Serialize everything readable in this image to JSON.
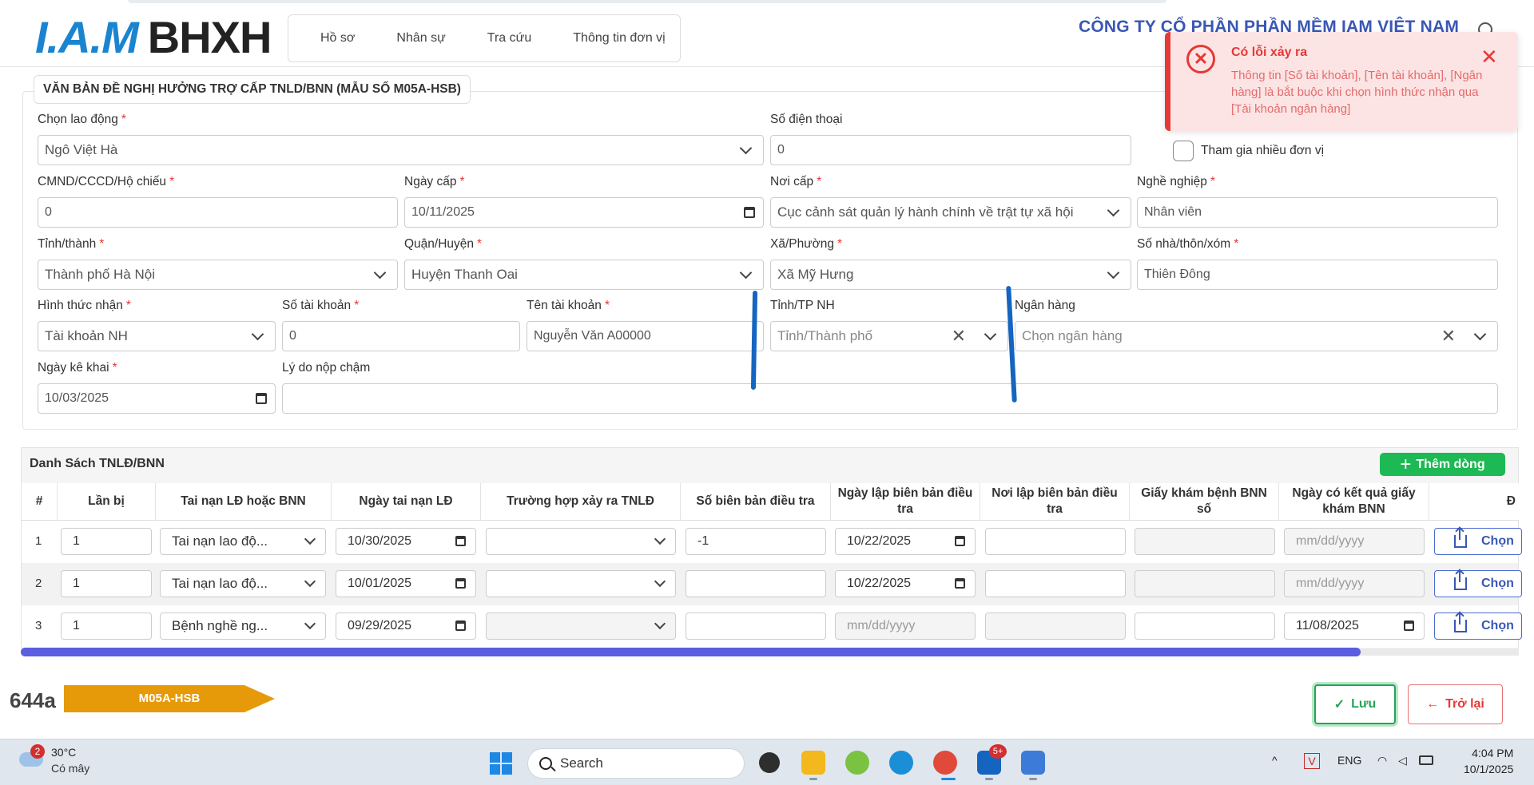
{
  "header": {
    "logo_iam": "I.A.M",
    "logo_bhxh": "BHXH",
    "nav": [
      "Hồ sơ",
      "Nhân sự",
      "Tra cứu",
      "Thông tin đơn vị"
    ],
    "company": "CÔNG TY CỔ PHẦN PHẦN MỀM IAM VIỆT NAM"
  },
  "toast": {
    "title": "Có lỗi xảy ra",
    "message": "Thông tin [Số tài khoản], [Tên tài khoản], [Ngân hàng] là bắt buộc khi chọn hình thức nhận qua [Tài khoản ngân hàng]",
    "close": "✕",
    "icon": "x-circle-icon"
  },
  "form": {
    "legend": "VĂN BẢN ĐỀ NGHỊ HƯỞNG TRỢ CẤP TNLD/BNN (MẪU SỐ M05A-HSB)",
    "required_mark": "*",
    "chon_lao_dong": {
      "label": "Chọn lao động",
      "value": "Ngô Việt Hà"
    },
    "so_dien_thoai": {
      "label": "Số điện thoại",
      "value": "0"
    },
    "tham_gia": {
      "label": "Tham gia nhiều đơn vị",
      "checked": false
    },
    "cmnd": {
      "label": "CMND/CCCD/Hộ chiếu",
      "value": "0"
    },
    "ngay_cap": {
      "label": "Ngày cấp",
      "value": "10/11/2025"
    },
    "noi_cap": {
      "label": "Nơi cấp",
      "value": "Cục cảnh sát quản lý hành chính về trật tự xã hội"
    },
    "nghe_nghiep": {
      "label": "Nghề nghiệp",
      "value": "Nhân viên"
    },
    "tinh_thanh": {
      "label": "Tỉnh/thành",
      "value": "Thành phố Hà Nội"
    },
    "quan_huyen": {
      "label": "Quận/Huyện",
      "value": "Huyện Thanh Oai"
    },
    "xa_phuong": {
      "label": "Xã/Phường",
      "value": "Xã Mỹ Hưng"
    },
    "so_nha": {
      "label": "Số nhà/thôn/xóm",
      "value": "Thiên Đông"
    },
    "hinh_thuc_nhan": {
      "label": "Hình thức nhận",
      "value": "Tài khoản NH"
    },
    "so_tai_khoan": {
      "label": "Số tài khoản",
      "value": "0"
    },
    "ten_tai_khoan": {
      "label": "Tên tài khoản",
      "value": "Nguyễn Văn A00000"
    },
    "tinh_tp_nh": {
      "label": "Tỉnh/TP NH",
      "placeholder": "Tỉnh/Thành phố"
    },
    "ngan_hang": {
      "label": "Ngân hàng",
      "placeholder": "Chọn ngân hàng"
    },
    "ngay_ke_khai": {
      "label": "Ngày kê khai",
      "value": "10/03/2025"
    },
    "ly_do": {
      "label": "Lý do nộp chậm",
      "value": ""
    },
    "clear_glyph": "✕"
  },
  "table": {
    "title": "Danh Sách TNLĐ/BNN",
    "add_label": "Thêm dòng",
    "add_icon": "+",
    "columns": [
      "#",
      "Lần bị",
      "Tai nạn LĐ hoặc BNN",
      "Ngày tai nạn LĐ",
      "Trường hợp xảy ra TNLĐ",
      "Số biên bản điều tra",
      "Ngày lập biên bản điều tra",
      "Nơi lập biên bản điều tra",
      "Giấy khám bệnh BNN số",
      "Ngày có kết quả giấy khám BNN",
      "Đ"
    ],
    "date_placeholder": "mm/dd/yyyy",
    "choose_label": "Chọn",
    "rows": [
      {
        "num": "1",
        "lan_bi": "1",
        "loai": "Tai nạn lao độ...",
        "ngay_tai_nan": "10/30/2025",
        "truong_hop": "",
        "so_bien_ban": "-1",
        "ngay_lap": "10/22/2025",
        "noi_lap": "",
        "giay_kham": "",
        "ngay_kq": ""
      },
      {
        "num": "2",
        "lan_bi": "1",
        "loai": "Tai nạn lao độ...",
        "ngay_tai_nan": "10/01/2025",
        "truong_hop": "",
        "so_bien_ban": "",
        "ngay_lap": "10/22/2025",
        "noi_lap": "",
        "giay_kham": "",
        "ngay_kq": ""
      },
      {
        "num": "3",
        "lan_bi": "1",
        "loai": "Bệnh nghề ng...",
        "ngay_tai_nan": "09/29/2025",
        "truong_hop": "",
        "so_bien_ban": "",
        "ngay_lap": "",
        "noi_lap": "",
        "giay_kham": "",
        "ngay_kq": "11/08/2025"
      }
    ]
  },
  "footer": {
    "code": "644a",
    "badge": "M05A-HSB",
    "save_label": "Lưu",
    "back_label": "Trở lại",
    "save_icon": "✓",
    "back_icon": "←"
  },
  "taskbar": {
    "weather_temp": "30°C",
    "weather_cond": "Có mây",
    "weather_badge": "2",
    "search_label": "Search",
    "zalo_badge": "5+",
    "lang": "ENG",
    "time": "4:04 PM",
    "date": "10/1/2025",
    "caret": "^"
  },
  "colors": {
    "primary": "#3a57b5",
    "error": "#e53935",
    "success": "#1db954",
    "badge": "#e69a0a",
    "scroll": "#5b5ee0"
  }
}
